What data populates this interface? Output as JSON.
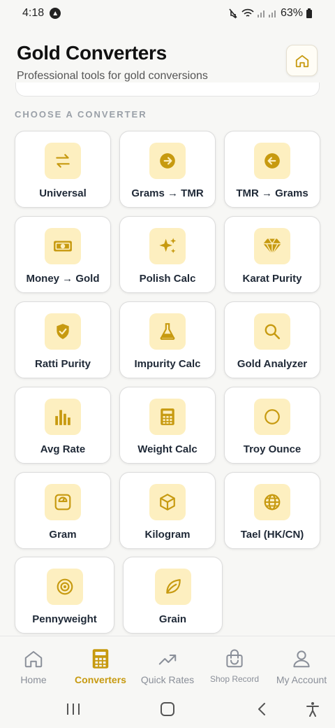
{
  "status": {
    "time": "4:18",
    "battery": "63%"
  },
  "header": {
    "title": "Gold Converters",
    "subtitle": "Professional tools for gold conversions"
  },
  "section": {
    "label": "CHOOSE A CONVERTER"
  },
  "converters": [
    {
      "label": "Universal",
      "icon": "swap-arrows-icon"
    },
    {
      "label": "Grams → TMR",
      "icon": "arrow-right-circle-icon"
    },
    {
      "label": "TMR → Grams",
      "icon": "arrow-left-circle-icon"
    },
    {
      "label": "Money → Gold",
      "icon": "banknote-icon"
    },
    {
      "label": "Polish Calc",
      "icon": "sparkles-icon"
    },
    {
      "label": "Karat Purity",
      "icon": "gem-icon"
    },
    {
      "label": "Ratti Purity",
      "icon": "shield-check-icon"
    },
    {
      "label": "Impurity Calc",
      "icon": "flask-icon"
    },
    {
      "label": "Gold Analyzer",
      "icon": "magnifier-icon"
    },
    {
      "label": "Avg Rate",
      "icon": "bar-chart-icon"
    },
    {
      "label": "Weight Calc",
      "icon": "calculator-icon"
    },
    {
      "label": "Troy Ounce",
      "icon": "circle-icon"
    },
    {
      "label": "Gram",
      "icon": "scale-icon"
    },
    {
      "label": "Kilogram",
      "icon": "box-icon"
    },
    {
      "label": "Tael (HK/CN)",
      "icon": "globe-icon"
    },
    {
      "label": "Pennyweight",
      "icon": "target-icon"
    },
    {
      "label": "Grain",
      "icon": "leaf-icon"
    }
  ],
  "nav": [
    {
      "label": "Home",
      "icon": "home-icon"
    },
    {
      "label": "Converters",
      "icon": "calculator-icon"
    },
    {
      "label": "Quick Rates",
      "icon": "trending-up-icon"
    },
    {
      "label": "Shop Record",
      "icon": "shopping-bag-icon"
    },
    {
      "label": "My Account",
      "icon": "user-icon"
    }
  ],
  "colors": {
    "accent": "#c79a10",
    "icon_bg": "#fdefc0",
    "background": "#f7f7f5"
  }
}
